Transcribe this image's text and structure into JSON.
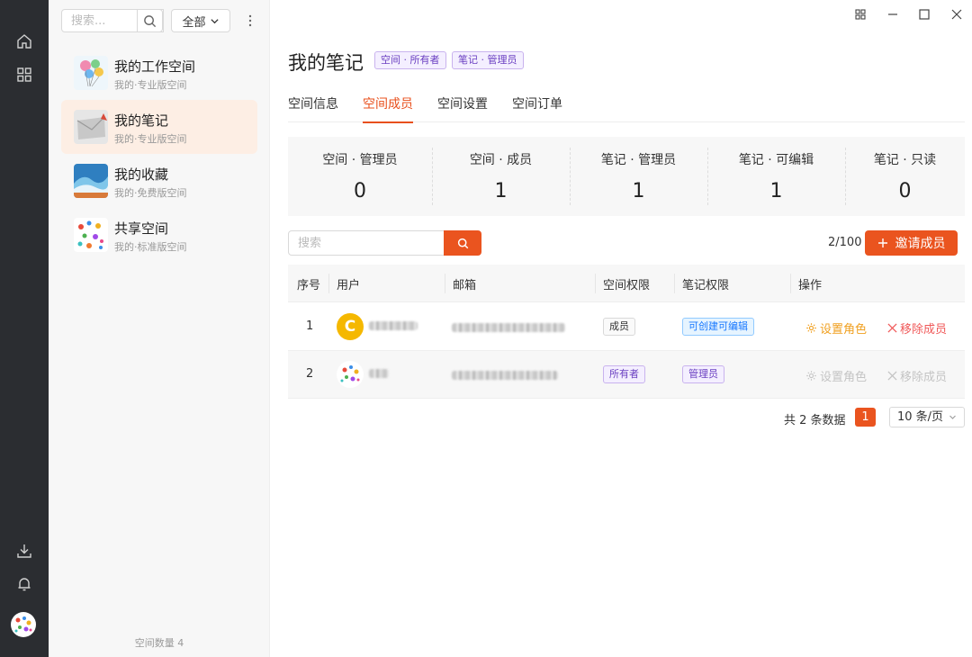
{
  "sidebar": {
    "search_placeholder": "搜索...",
    "filter_label": "全部",
    "spaces": [
      {
        "name": "我的工作空间",
        "subtitle": "我的·专业版空间"
      },
      {
        "name": "我的笔记",
        "subtitle": "我的·专业版空间"
      },
      {
        "name": "我的收藏",
        "subtitle": "我的·免费版空间"
      },
      {
        "name": "共享空间",
        "subtitle": "我的·标准版空间"
      }
    ],
    "footer": "空间数量 4"
  },
  "header": {
    "title": "我的笔记",
    "badges": [
      "空间 · 所有者",
      "笔记 · 管理员"
    ]
  },
  "tabs": [
    "空间信息",
    "空间成员",
    "空间设置",
    "空间订单"
  ],
  "stats": [
    {
      "label": "空间 · 管理员",
      "value": "0"
    },
    {
      "label": "空间 · 成员",
      "value": "1"
    },
    {
      "label": "笔记 · 管理员",
      "value": "1"
    },
    {
      "label": "笔记 · 可编辑",
      "value": "1"
    },
    {
      "label": "笔记 · 只读",
      "value": "0"
    }
  ],
  "members": {
    "search_placeholder": "搜索",
    "count": "2/100",
    "invite_label": "邀请成员",
    "columns": [
      "序号",
      "用户",
      "邮箱",
      "空间权限",
      "笔记权限",
      "操作"
    ],
    "rows": [
      {
        "index": "1",
        "avatar_letter": "C",
        "space_role": "成员",
        "note_role": "可创建可编辑",
        "set_role": "设置角色",
        "remove": "移除成员"
      },
      {
        "index": "2",
        "avatar_letter": "",
        "space_role": "所有者",
        "note_role": "管理员",
        "set_role": "设置角色",
        "remove": "移除成员"
      }
    ]
  },
  "pagination": {
    "total": "共 2 条数据",
    "current": "1",
    "page_size": "10 条/页"
  },
  "colors": {
    "accent": "#ea541f",
    "rail": "#2b2d31",
    "active_item": "#fdeee4"
  },
  "icons": {
    "rail": [
      "home-icon",
      "apps-grid-icon",
      "download-icon",
      "bell-icon"
    ],
    "window": [
      "layout-icon",
      "minimize-icon",
      "maximize-icon",
      "close-icon"
    ]
  }
}
